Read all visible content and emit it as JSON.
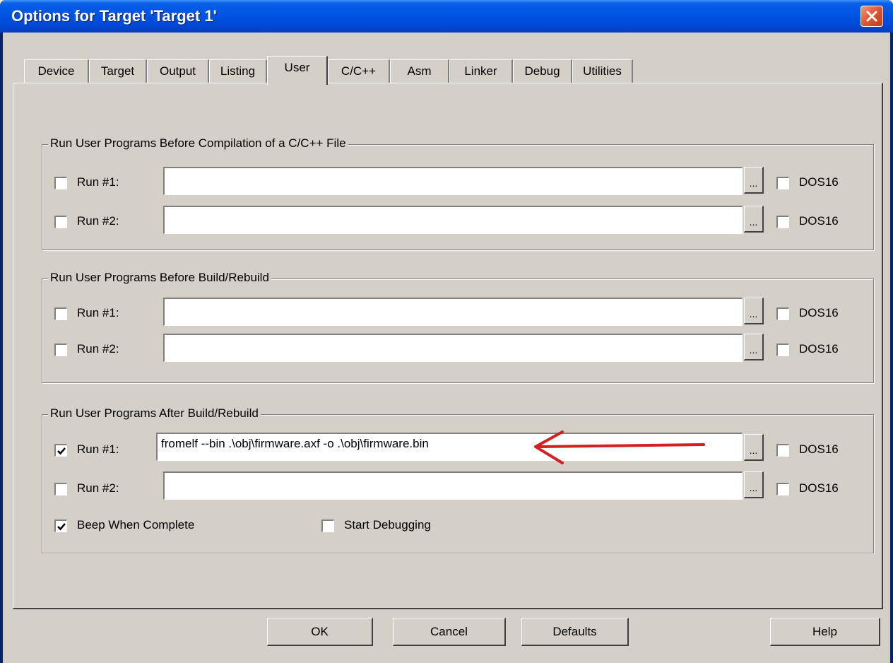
{
  "window": {
    "title": "Options for Target 'Target 1'"
  },
  "tabs": [
    "Device",
    "Target",
    "Output",
    "Listing",
    "User",
    "C/C++",
    "Asm",
    "Linker",
    "Debug",
    "Utilities"
  ],
  "active_tab": "User",
  "groups": {
    "before_compile": {
      "title": "Run User Programs Before Compilation of a C/C++ File",
      "run1": {
        "label": "Run #1:",
        "checked": false,
        "value": "",
        "dos16_label": "DOS16",
        "dos16": false
      },
      "run2": {
        "label": "Run #2:",
        "checked": false,
        "value": "",
        "dos16_label": "DOS16",
        "dos16": false
      }
    },
    "before_build": {
      "title": "Run User Programs Before Build/Rebuild",
      "run1": {
        "label": "Run #1:",
        "checked": false,
        "value": "",
        "dos16_label": "DOS16",
        "dos16": false
      },
      "run2": {
        "label": "Run #2:",
        "checked": false,
        "value": "",
        "dos16_label": "DOS16",
        "dos16": false
      }
    },
    "after_build": {
      "title": "Run User Programs After Build/Rebuild",
      "run1": {
        "label": "Run #1:",
        "checked": true,
        "value": "fromelf --bin .\\obj\\firmware.axf -o .\\obj\\firmware.bin",
        "dos16_label": "DOS16",
        "dos16": false
      },
      "run2": {
        "label": "Run #2:",
        "checked": false,
        "value": "",
        "dos16_label": "DOS16",
        "dos16": false
      },
      "beep": {
        "label": "Beep When Complete",
        "checked": true
      },
      "start_debugging": {
        "label": "Start Debugging",
        "checked": false
      }
    }
  },
  "browse_label": "...",
  "buttons": {
    "ok": "OK",
    "cancel": "Cancel",
    "defaults": "Defaults",
    "help": "Help"
  },
  "colors": {
    "titlebar": "#0054e3",
    "dialog_face": "#d4d0c8",
    "annotation_arrow": "#d42020"
  }
}
